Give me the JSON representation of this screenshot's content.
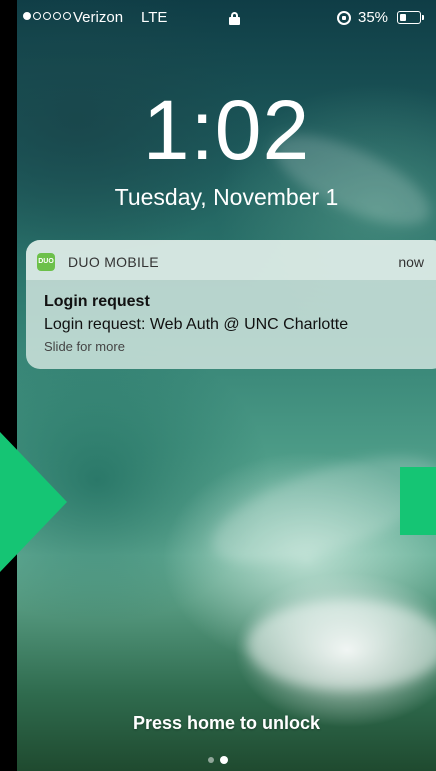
{
  "status_bar": {
    "signal_dots_filled": 1,
    "signal_dots_total": 5,
    "carrier": "Verizon",
    "network": "LTE",
    "battery_percent": "35%",
    "battery_level": 0.35,
    "icons": [
      "signal-icon",
      "lock-icon",
      "orientation-lock-icon",
      "battery-icon"
    ]
  },
  "lock_screen": {
    "time": "1:02",
    "date": "Tuesday, November 1",
    "unlock_hint": "Press home to unlock",
    "page_count": 2,
    "active_page": 1
  },
  "notification": {
    "app_icon_text": "DUO",
    "app_name": "DUO MOBILE",
    "time": "now",
    "title": "Login request",
    "body": "Login request: Web Auth @ UNC Charlotte",
    "more": "Slide for more"
  },
  "colors": {
    "accent_green": "#15c574",
    "duo_icon": "#6cc04a",
    "notification_bg": "#d6e8e2"
  }
}
